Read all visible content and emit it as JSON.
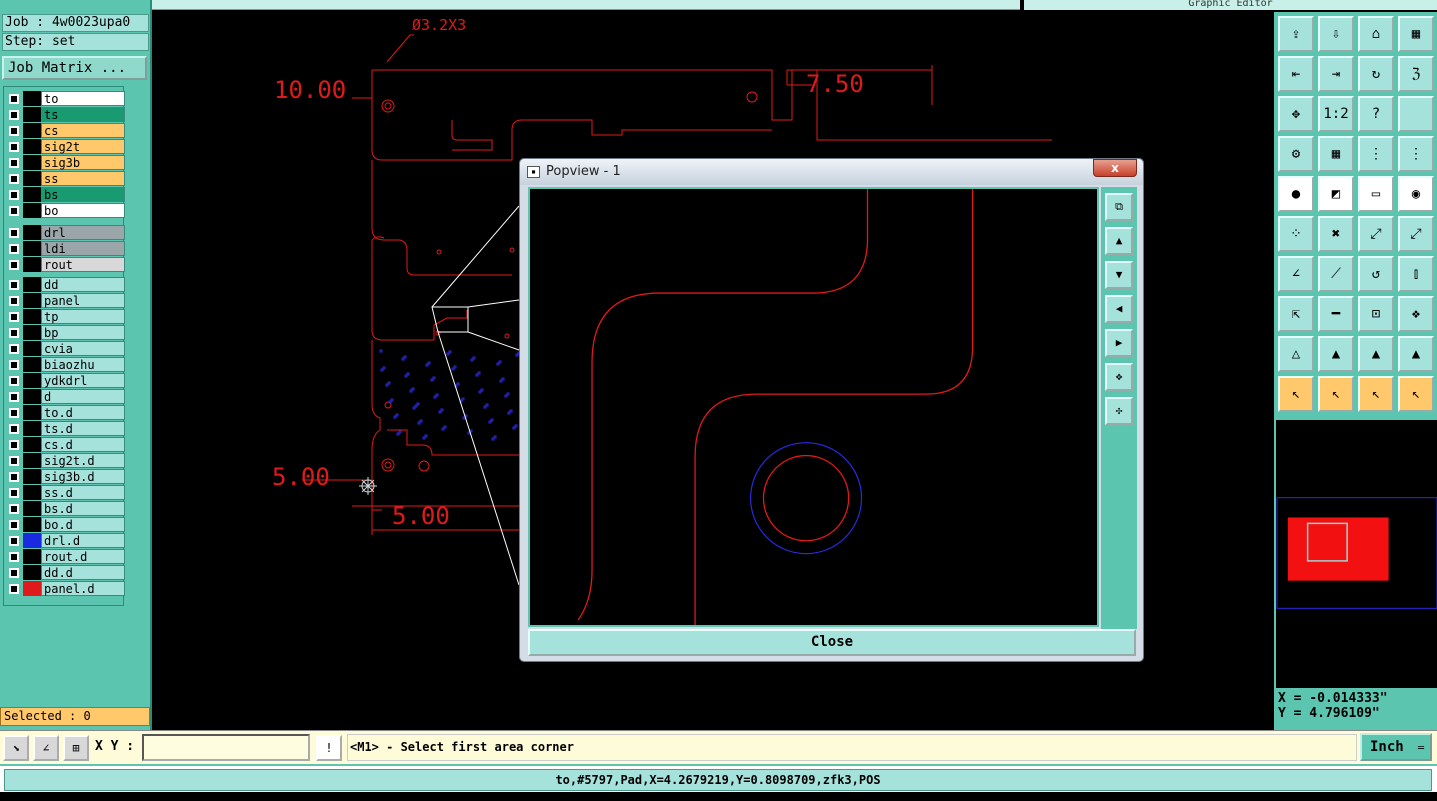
{
  "app": {
    "graphic_editor_title": "Graphic Editor",
    "job_line": "Job : 4w0023upa0",
    "step_line": "Step: set",
    "job_matrix_button": "Job Matrix ..."
  },
  "layers_group1": [
    {
      "name": "to",
      "color": "#ffffff",
      "swatch": "#000000"
    },
    {
      "name": "ts",
      "color": "#1a9a70",
      "swatch": "#000000"
    },
    {
      "name": "cs",
      "color": "#ffc86a",
      "swatch": "#000000"
    },
    {
      "name": "sig2t",
      "color": "#ffc86a",
      "swatch": "#000000"
    },
    {
      "name": "sig3b",
      "color": "#ffc86a",
      "swatch": "#000000"
    },
    {
      "name": "ss",
      "color": "#ffc86a",
      "swatch": "#000000"
    },
    {
      "name": "bs",
      "color": "#1a9a70",
      "swatch": "#000000"
    },
    {
      "name": "bo",
      "color": "#ffffff",
      "swatch": "#000000"
    }
  ],
  "layers_group2": [
    {
      "name": "drl",
      "color": "#9aa6aa",
      "swatch": "#000000"
    },
    {
      "name": "ldi",
      "color": "#9aa6aa",
      "swatch": "#000000"
    },
    {
      "name": "rout",
      "color": "#d8d8d8",
      "swatch": "#000000"
    }
  ],
  "layers_group3": [
    {
      "name": "dd",
      "color": "#a6e2dc",
      "swatch": "#000000"
    },
    {
      "name": "panel",
      "color": "#a6e2dc",
      "swatch": "#000000"
    },
    {
      "name": "tp",
      "color": "#a6e2dc",
      "swatch": "#000000"
    },
    {
      "name": "bp",
      "color": "#a6e2dc",
      "swatch": "#000000"
    },
    {
      "name": "cvia",
      "color": "#a6e2dc",
      "swatch": "#000000"
    },
    {
      "name": "biaozhu",
      "color": "#a6e2dc",
      "swatch": "#000000"
    },
    {
      "name": "ydkdrl",
      "color": "#a6e2dc",
      "swatch": "#000000"
    },
    {
      "name": "d",
      "color": "#a6e2dc",
      "swatch": "#000000"
    },
    {
      "name": "to.d",
      "color": "#a6e2dc",
      "swatch": "#000000"
    },
    {
      "name": "ts.d",
      "color": "#a6e2dc",
      "swatch": "#000000"
    },
    {
      "name": "cs.d",
      "color": "#a6e2dc",
      "swatch": "#000000"
    },
    {
      "name": "sig2t.d",
      "color": "#a6e2dc",
      "swatch": "#000000"
    },
    {
      "name": "sig3b.d",
      "color": "#a6e2dc",
      "swatch": "#000000"
    },
    {
      "name": "ss.d",
      "color": "#a6e2dc",
      "swatch": "#000000"
    },
    {
      "name": "bs.d",
      "color": "#a6e2dc",
      "swatch": "#000000"
    },
    {
      "name": "bo.d",
      "color": "#a6e2dc",
      "swatch": "#000000"
    },
    {
      "name": "drl.d",
      "color": "#a6e2dc",
      "swatch": "#1a2ae0"
    },
    {
      "name": "rout.d",
      "color": "#a6e2dc",
      "swatch": "#000000"
    },
    {
      "name": "dd.d",
      "color": "#a6e2dc",
      "swatch": "#000000"
    },
    {
      "name": "panel.d",
      "color": "#a6e2dc",
      "swatch": "#e01a1a"
    }
  ],
  "selected_text": "Selected : 0",
  "canvas": {
    "dim_top_left": "10.00",
    "dim_top_right": "7.50",
    "dim_hole": "Ø3.2X3",
    "dim_bottom_left": "5.00",
    "dim_bottom": "5.00"
  },
  "popview": {
    "title": "Popview - 1",
    "close_x": "x",
    "close_button": "Close"
  },
  "coords": {
    "x": "X = -0.014333\"",
    "y": "Y = 4.796109\""
  },
  "bottom": {
    "xy_label": "X Y :",
    "xy_value": "",
    "message": "<M1> - Select first area corner",
    "unit": "Inch",
    "status": "to,#5797,Pad,X=4.2679219,Y=0.8098709,zfk3,POS"
  },
  "colors": {
    "accent": "#5cc5b0",
    "board_line": "#e01a1a",
    "drill": "#2a2ae0"
  }
}
